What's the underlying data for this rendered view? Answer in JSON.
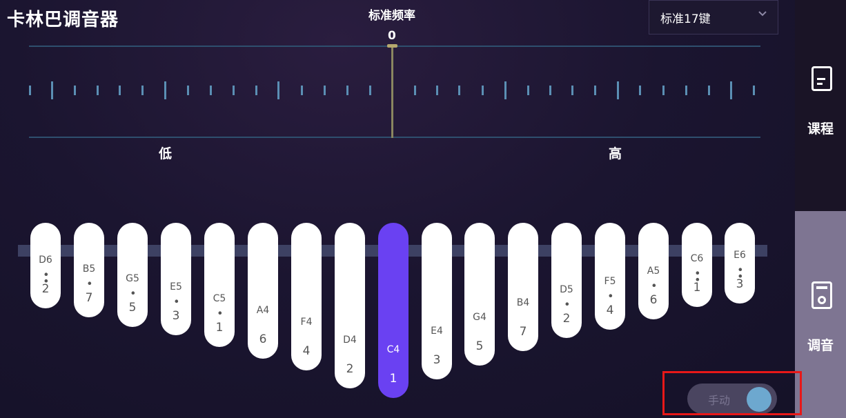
{
  "header": {
    "app_title": "卡林巴调音器",
    "frequency_title": "标准频率",
    "key_select": {
      "value": "标准17键",
      "icon": "chevron-down-icon"
    }
  },
  "tuner": {
    "cents_value": "0",
    "low_label": "低",
    "high_label": "高"
  },
  "tines": [
    {
      "note": "D6",
      "dots": "••",
      "num": "2",
      "active": false
    },
    {
      "note": "B5",
      "dots": "•",
      "num": "7",
      "active": false
    },
    {
      "note": "G5",
      "dots": "•",
      "num": "5",
      "active": false
    },
    {
      "note": "E5",
      "dots": "•",
      "num": "3",
      "active": false
    },
    {
      "note": "C5",
      "dots": "•",
      "num": "1",
      "active": false
    },
    {
      "note": "A4",
      "dots": "",
      "num": "6",
      "active": false
    },
    {
      "note": "F4",
      "dots": "",
      "num": "4",
      "active": false
    },
    {
      "note": "D4",
      "dots": "",
      "num": "2",
      "active": false
    },
    {
      "note": "C4",
      "dots": "",
      "num": "1",
      "active": true
    },
    {
      "note": "E4",
      "dots": "",
      "num": "3",
      "active": false
    },
    {
      "note": "G4",
      "dots": "",
      "num": "5",
      "active": false
    },
    {
      "note": "B4",
      "dots": "",
      "num": "7",
      "active": false
    },
    {
      "note": "D5",
      "dots": "•",
      "num": "2",
      "active": false
    },
    {
      "note": "F5",
      "dots": "•",
      "num": "4",
      "active": false
    },
    {
      "note": "A5",
      "dots": "•",
      "num": "6",
      "active": false
    },
    {
      "note": "C6",
      "dots": "••",
      "num": "1",
      "active": false
    },
    {
      "note": "E6",
      "dots": "••",
      "num": "3",
      "active": false
    }
  ],
  "sidebar": {
    "items": [
      {
        "label": "课程",
        "icon": "book-icon"
      },
      {
        "label": "调音",
        "icon": "tuner-icon",
        "active": true
      }
    ]
  },
  "toggle": {
    "label": "手动",
    "on": true
  },
  "colors": {
    "accent": "#6a41f2",
    "tick": "#5b8fb4",
    "highlight": "#e81818",
    "toggle_knob": "#6da8cf"
  }
}
